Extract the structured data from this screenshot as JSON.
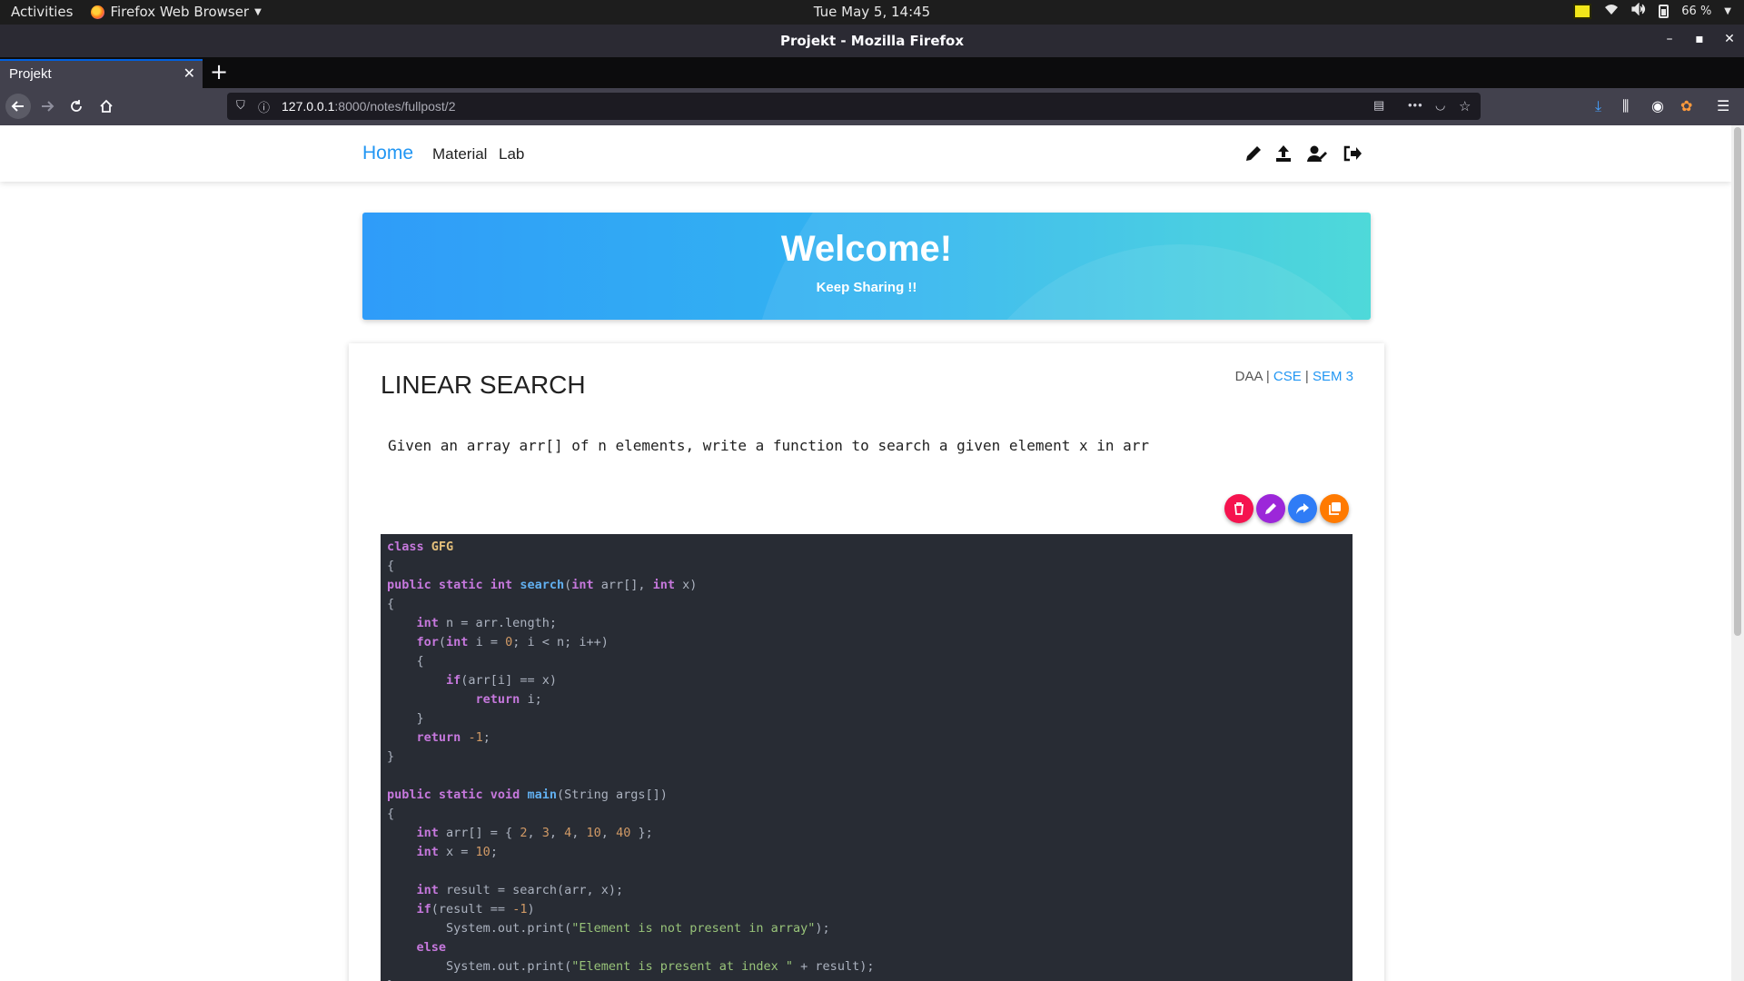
{
  "system": {
    "activities": "Activities",
    "app_name": "Firefox Web Browser",
    "clock": "Tue May  5, 14:45",
    "battery": "66 %"
  },
  "browser": {
    "window_title": "Projekt - Mozilla Firefox",
    "tab_title": "Projekt",
    "url_host": "127.0.0.1",
    "url_path": ":8000/notes/fullpost/2"
  },
  "site": {
    "brand": "Home",
    "nav": [
      "Material",
      "Lab"
    ],
    "hero_title": "Welcome!",
    "hero_subtitle": "Keep Sharing !!"
  },
  "post": {
    "title": "LINEAR SEARCH",
    "subject": "DAA",
    "branch": "CSE",
    "semester": "SEM 3",
    "separator": "|",
    "description": "Given an array arr[] of n elements, write a function to search a given element x in arr",
    "actions": [
      "delete-icon",
      "edit-icon",
      "share-icon",
      "copy-icon"
    ]
  },
  "code": [
    [
      [
        "kw",
        "class"
      ],
      [
        "t",
        " "
      ],
      [
        "cls",
        "GFG"
      ]
    ],
    [
      [
        "t",
        "{"
      ]
    ],
    [
      [
        "kw",
        "public static int"
      ],
      [
        "t",
        " "
      ],
      [
        "fn",
        "search"
      ],
      [
        "t",
        "("
      ],
      [
        "kw",
        "int"
      ],
      [
        "t",
        " arr[], "
      ],
      [
        "kw",
        "int"
      ],
      [
        "t",
        " x)"
      ]
    ],
    [
      [
        "t",
        "{"
      ]
    ],
    [
      [
        "t",
        "    "
      ],
      [
        "kw",
        "int"
      ],
      [
        "t",
        " n = arr.length;"
      ]
    ],
    [
      [
        "t",
        "    "
      ],
      [
        "kw",
        "for"
      ],
      [
        "t",
        "("
      ],
      [
        "kw",
        "int"
      ],
      [
        "t",
        " i = "
      ],
      [
        "num",
        "0"
      ],
      [
        "t",
        "; i < n; i++)"
      ]
    ],
    [
      [
        "t",
        "    {"
      ]
    ],
    [
      [
        "t",
        "        "
      ],
      [
        "kw",
        "if"
      ],
      [
        "t",
        "(arr[i] == x)"
      ]
    ],
    [
      [
        "t",
        "            "
      ],
      [
        "kw",
        "return"
      ],
      [
        "t",
        " i;"
      ]
    ],
    [
      [
        "t",
        "    }"
      ]
    ],
    [
      [
        "t",
        "    "
      ],
      [
        "kw",
        "return"
      ],
      [
        "t",
        " "
      ],
      [
        "num",
        "-1"
      ],
      [
        "t",
        ";"
      ]
    ],
    [
      [
        "t",
        "}"
      ]
    ],
    [
      [
        "t",
        ""
      ]
    ],
    [
      [
        "kw",
        "public static void"
      ],
      [
        "t",
        " "
      ],
      [
        "fn",
        "main"
      ],
      [
        "t",
        "(String args[])"
      ]
    ],
    [
      [
        "t",
        "{"
      ]
    ],
    [
      [
        "t",
        "    "
      ],
      [
        "kw",
        "int"
      ],
      [
        "t",
        " arr[] = { "
      ],
      [
        "num",
        "2"
      ],
      [
        "t",
        ", "
      ],
      [
        "num",
        "3"
      ],
      [
        "t",
        ", "
      ],
      [
        "num",
        "4"
      ],
      [
        "t",
        ", "
      ],
      [
        "num",
        "10"
      ],
      [
        "t",
        ", "
      ],
      [
        "num",
        "40"
      ],
      [
        "t",
        " };"
      ]
    ],
    [
      [
        "t",
        "    "
      ],
      [
        "kw",
        "int"
      ],
      [
        "t",
        " x = "
      ],
      [
        "num",
        "10"
      ],
      [
        "t",
        ";"
      ]
    ],
    [
      [
        "t",
        ""
      ]
    ],
    [
      [
        "t",
        "    "
      ],
      [
        "kw",
        "int"
      ],
      [
        "t",
        " result = search(arr, x);"
      ]
    ],
    [
      [
        "t",
        "    "
      ],
      [
        "kw",
        "if"
      ],
      [
        "t",
        "(result == "
      ],
      [
        "num",
        "-1"
      ],
      [
        "t",
        ")"
      ]
    ],
    [
      [
        "t",
        "        System.out.print("
      ],
      [
        "str",
        "\"Element is not present in array\""
      ],
      [
        "t",
        ");"
      ]
    ],
    [
      [
        "t",
        "    "
      ],
      [
        "kw",
        "else"
      ]
    ],
    [
      [
        "t",
        "        System.out.print("
      ],
      [
        "str",
        "\"Element is present at index \""
      ],
      [
        "t",
        " + result);"
      ]
    ],
    [
      [
        "t",
        "}"
      ]
    ]
  ]
}
